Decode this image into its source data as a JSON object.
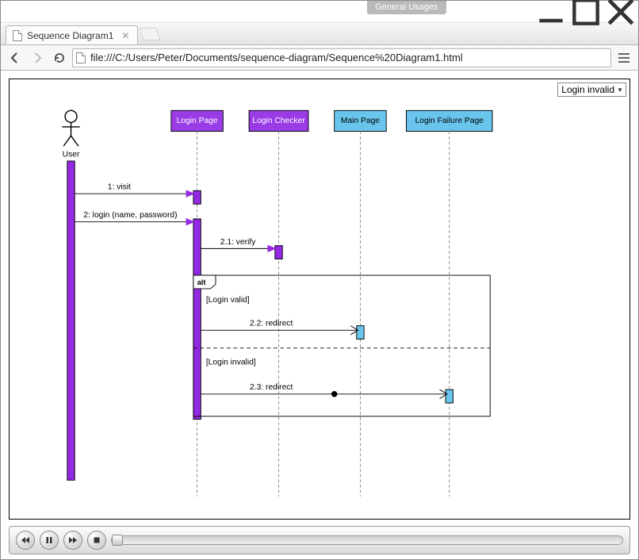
{
  "titlebar": {
    "taskbar_label": "General Usages"
  },
  "tab": {
    "title": "Sequence Diagram1"
  },
  "toolbar": {
    "url": "file:///C:/Users/Peter/Documents/sequence-diagram/Sequence%20Diagram1.html"
  },
  "scenario": {
    "selected": "Login invalid"
  },
  "diagram": {
    "actor": {
      "name": "User"
    },
    "lifelines": [
      {
        "id": "login_page",
        "label": "Login Page",
        "color": "purple"
      },
      {
        "id": "login_checker",
        "label": "Login Checker",
        "color": "purple"
      },
      {
        "id": "main_page",
        "label": "Main Page",
        "color": "blue"
      },
      {
        "id": "login_failure_page",
        "label": "Login Failure Page",
        "color": "blue"
      }
    ],
    "messages": {
      "m1": "1: visit",
      "m2": "2: login (name, password)",
      "m2_1": "2.1: verify",
      "m2_2": "2.2: redirect",
      "m2_3": "2.3: redirect"
    },
    "fragment": {
      "type": "alt",
      "guards": [
        "[Login valid]",
        "[Login invalid]"
      ]
    }
  }
}
